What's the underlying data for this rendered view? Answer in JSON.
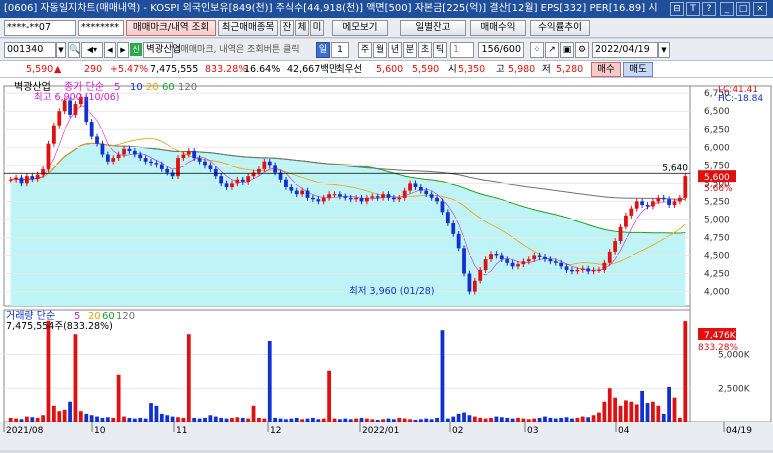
{
  "window": {
    "title": "[0606] 자동일지차트(매매내역) - KOSPI 외국인보유[849(천)] 주식수[44,918(천)] 액면[500] 자본금[225(억)] 결산[12월] EPS[332] PER[16.89] 시",
    "buttons": [
      "⊟",
      "T",
      "?",
      "_",
      "□",
      "×"
    ]
  },
  "toolbar1": {
    "account": "****-**07",
    "password": "********",
    "btn_trade_mark": "매매마크/내역 조회",
    "btn_recent": "최근매매종목",
    "btn_jan": "잔",
    "btn_che": "체",
    "btn_mi": "미",
    "btn_memo": "메모보기",
    "btn_daily_balance": "일별잔고",
    "btn_trade_profit": "매매수익",
    "btn_return_trend": "수익률추이"
  },
  "toolbar2": {
    "code": "001340",
    "stock_name": "벽광산업",
    "note": "*매매마크, 내역은 조회버튼 클릭",
    "period_buttons": [
      "일",
      "1",
      "주",
      "월",
      "년",
      "분",
      "초",
      "틱"
    ],
    "interval": "1",
    "count": "156/600",
    "date": "2022/04/19"
  },
  "quote": {
    "price": "5,590",
    "arrow": "▲",
    "change": "290",
    "change_pct": "+5.47%",
    "volume": "7,475,555",
    "vol_ratio": "833.28%",
    "turnover": "16.64%",
    "amount": "42,667백만",
    "priority_label": "최우선",
    "ask": "5,600",
    "bid": "5,590",
    "open_label": "시",
    "open": "5,350",
    "high_label": "고",
    "high": "5,980",
    "low_label": "저",
    "low": "5,280",
    "buy_label": "매수",
    "sell_label": "매도"
  },
  "chart_data": [
    {
      "type": "candlestick",
      "title": "벽광산업",
      "legend_label": "종가 단순",
      "ma_periods": [
        "5",
        "10",
        "20",
        "60",
        "120"
      ],
      "ma_colors": [
        "#d020d0",
        "#1030d0",
        "#f0a000",
        "#20a020",
        "#707070"
      ],
      "high_annotation": "최고 6,900 (10/06)",
      "low_annotation": "최저 3,960 (01/28)",
      "ylim": [
        3800,
        6850
      ],
      "y_ticks": [
        4000,
        4250,
        4500,
        4750,
        5000,
        5250,
        5500,
        5750,
        6000,
        6250,
        6500,
        6750
      ],
      "ref_line": 5640,
      "ref_label": "5,640",
      "right_labels": [
        "LC:41.41",
        "HC:-18.84"
      ],
      "current_price_label": "5,600",
      "current_pct_label": "5.66%",
      "close_series": [
        5550,
        5580,
        5500,
        5600,
        5560,
        5620,
        5700,
        6050,
        6300,
        6500,
        6650,
        6450,
        6600,
        6700,
        6350,
        6150,
        6050,
        5900,
        5800,
        5850,
        5900,
        5980,
        5950,
        5900,
        5850,
        5800,
        5780,
        5760,
        5700,
        5650,
        5600,
        5850,
        5900,
        5950,
        5850,
        5800,
        5750,
        5700,
        5600,
        5500,
        5450,
        5500,
        5550,
        5520,
        5600,
        5650,
        5700,
        5800,
        5750,
        5650,
        5550,
        5450,
        5400,
        5350,
        5400,
        5300,
        5280,
        5250,
        5300,
        5350,
        5350,
        5320,
        5300,
        5280,
        5300,
        5250,
        5300,
        5320,
        5300,
        5350,
        5300,
        5280,
        5300,
        5400,
        5500,
        5450,
        5400,
        5350,
        5300,
        5250,
        5100,
        4950,
        4800,
        4600,
        4250,
        4000,
        4150,
        4300,
        4450,
        4520,
        4500,
        4450,
        4400,
        4350,
        4380,
        4420,
        4450,
        4500,
        4480,
        4450,
        4420,
        4400,
        4350,
        4300,
        4280,
        4300,
        4320,
        4280,
        4300,
        4300,
        4400,
        4550,
        4700,
        4900,
        5050,
        5150,
        5250,
        5200,
        5180,
        5250,
        5300,
        5280,
        5200,
        5250,
        5300,
        5600
      ],
      "x_axis": [
        "2021/08",
        "10",
        "11",
        "12",
        "2022/01",
        "02",
        "03",
        "04",
        "04/19"
      ]
    },
    {
      "type": "bar",
      "legend_label": "거래량 단순",
      "ma_periods": [
        "5",
        "20",
        "60",
        "120"
      ],
      "volume_label": "7,475,554주(833.28%)",
      "y_ticks": [
        "5,000K",
        "2,500K"
      ],
      "current_volume_label": "7,476K",
      "current_pct_label": "833.28%",
      "ylim": [
        0,
        8000
      ],
      "values": [
        300,
        250,
        200,
        400,
        350,
        300,
        500,
        7500,
        1200,
        800,
        900,
        1500,
        6500,
        800,
        600,
        500,
        400,
        300,
        350,
        300,
        3500,
        400,
        300,
        250,
        300,
        250,
        1400,
        1200,
        600,
        500,
        400,
        350,
        300,
        6500,
        300,
        250,
        300,
        500,
        400,
        300,
        250,
        300,
        350,
        300,
        250,
        1200,
        300,
        250,
        6000,
        300,
        250,
        200,
        250,
        300,
        200,
        250,
        300,
        200,
        250,
        3800,
        250,
        200,
        250,
        200,
        250,
        300,
        250,
        200,
        150,
        200,
        250,
        200,
        300,
        250,
        200,
        150,
        200,
        250,
        200,
        300,
        6800,
        250,
        400,
        600,
        700,
        500,
        400,
        300,
        250,
        300,
        400,
        350,
        300,
        250,
        300,
        250,
        200,
        250,
        300,
        400,
        300,
        250,
        300,
        350,
        250,
        300,
        400,
        350,
        500,
        700,
        1500,
        2500,
        1800,
        1200,
        1600,
        1500,
        1300,
        2300,
        1400,
        1500,
        1200,
        600,
        2600,
        1800,
        300,
        7476
      ]
    }
  ]
}
